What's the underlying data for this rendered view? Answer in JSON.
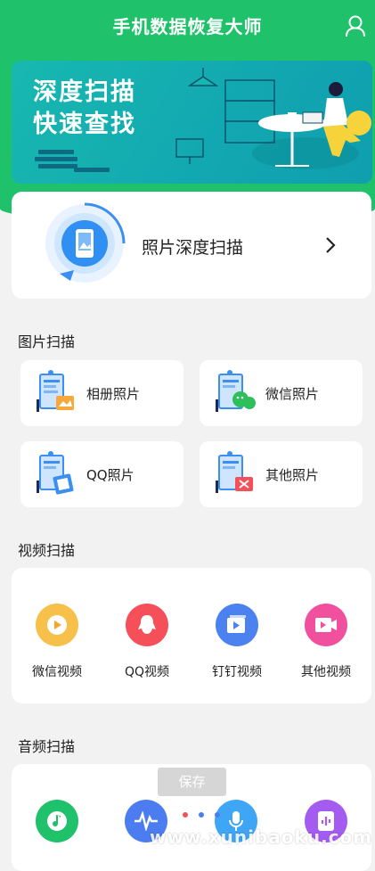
{
  "app": {
    "title": "手机数据恢复大师"
  },
  "banner": {
    "line1": "深度扫描",
    "line2": "快速查找"
  },
  "deep_scan": {
    "label": "照片深度扫描"
  },
  "image_scan": {
    "title": "图片扫描",
    "items": [
      {
        "label": "相册照片",
        "icon": "album-photo-icon"
      },
      {
        "label": "微信照片",
        "icon": "wechat-photo-icon"
      },
      {
        "label": "QQ照片",
        "icon": "qq-photo-icon"
      },
      {
        "label": "其他照片",
        "icon": "other-photo-icon"
      }
    ]
  },
  "video_scan": {
    "title": "视频扫描",
    "items": [
      {
        "label": "微信视频",
        "color": "#f6c04a"
      },
      {
        "label": "QQ视频",
        "color": "#f5505a"
      },
      {
        "label": "钉钉视频",
        "color": "#4b82f0"
      },
      {
        "label": "其他视频",
        "color": "#f0509e"
      }
    ]
  },
  "audio_scan": {
    "title": "音频扫描",
    "items": [
      {
        "icon": "music-note-icon",
        "color": "#1fc26a"
      },
      {
        "icon": "waveform-icon",
        "color": "#4b7df0"
      },
      {
        "icon": "microphone-icon",
        "color": "#3fa6f5"
      },
      {
        "icon": "audio-file-icon",
        "color": "#a45cf0"
      }
    ]
  },
  "toast": {
    "label": "保存"
  },
  "pager": {
    "dot_colors": [
      "#ffffff",
      "#f5505a",
      "#4b7df0",
      "#4b7df0"
    ]
  },
  "watermark": {
    "text": "www.xunibaoku.com"
  },
  "colors": {
    "brand_green": "#1fc26a",
    "banner_teal": "#12a7b1"
  }
}
